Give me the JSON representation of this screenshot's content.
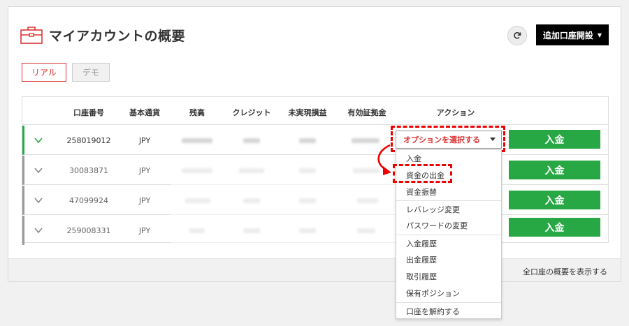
{
  "header": {
    "title": "マイアカウントの概要",
    "add_account_label": "追加口座開設"
  },
  "tabs": [
    {
      "label": "リアル",
      "active": true
    },
    {
      "label": "デモ",
      "active": false
    }
  ],
  "table": {
    "columns": [
      "口座番号",
      "基本通貨",
      "残高",
      "クレジット",
      "未実現損益",
      "有効証拠金",
      "アクション"
    ],
    "rows": [
      {
        "account": "258019012",
        "currency": "JPY",
        "active": true
      },
      {
        "account": "30083871",
        "currency": "JPY",
        "active": false
      },
      {
        "account": "47099924",
        "currency": "JPY",
        "active": false
      },
      {
        "account": "259008331",
        "currency": "JPY",
        "active": false
      }
    ],
    "deposit_label": "入金"
  },
  "action_select": {
    "placeholder": "オプションを選択する",
    "options": [
      "入金",
      "資金の出金",
      "資金振替",
      "レバレッジ変更",
      "パスワードの変更",
      "入金履歴",
      "出金履歴",
      "取引履歴",
      "保有ポジション",
      "口座を解約する"
    ]
  },
  "footer": {
    "link_label": "全口座の概要を表示する"
  },
  "colors": {
    "accent_red": "#dd3333",
    "deposit_green": "#28a745",
    "highlight_red": "#ee0000"
  }
}
